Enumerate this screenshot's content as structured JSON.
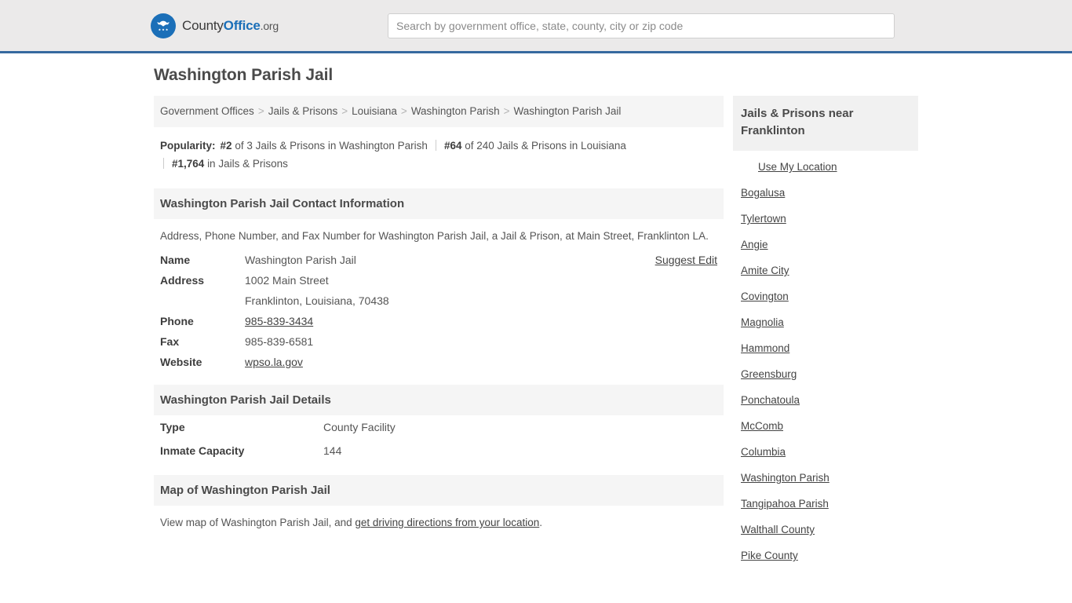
{
  "header": {
    "brand": {
      "part1": "County",
      "part2": "Office",
      "part3": ".org",
      "logo_icon": "eagle-seal-icon"
    },
    "search": {
      "placeholder": "Search by government office, state, county, city or zip code",
      "value": ""
    },
    "accent_color": "#36699f",
    "background_color": "#ebeaea"
  },
  "page": {
    "title": "Washington Parish Jail"
  },
  "breadcrumb": {
    "separator": ">",
    "items": [
      {
        "label": "Government Offices",
        "current": false
      },
      {
        "label": "Jails & Prisons",
        "current": false
      },
      {
        "label": "Louisiana",
        "current": false
      },
      {
        "label": "Washington Parish",
        "current": false
      },
      {
        "label": "Washington Parish Jail",
        "current": true
      }
    ]
  },
  "popularity": {
    "label": "Popularity:",
    "stats": [
      {
        "rank": "#2",
        "text": "of 3 Jails & Prisons in Washington Parish"
      },
      {
        "rank": "#64",
        "text": "of 240 Jails & Prisons in Louisiana"
      },
      {
        "rank": "#1,764",
        "text": "in Jails & Prisons"
      }
    ]
  },
  "contact": {
    "heading": "Washington Parish Jail Contact Information",
    "description": "Address, Phone Number, and Fax Number for Washington Parish Jail, a Jail & Prison, at Main Street, Franklinton LA.",
    "suggest_edit": "Suggest Edit",
    "rows": [
      {
        "key": "Name",
        "value": "Washington Parish Jail",
        "link": false
      },
      {
        "key": "Address",
        "value": "1002 Main Street",
        "link": false
      },
      {
        "key": "",
        "value": "Franklinton, Louisiana, 70438",
        "link": false
      },
      {
        "key": "Phone",
        "value": "985-839-3434",
        "link": true
      },
      {
        "key": "Fax",
        "value": "985-839-6581",
        "link": false
      },
      {
        "key": "Website",
        "value": "wpso.la.gov",
        "link": true
      }
    ]
  },
  "details": {
    "heading": "Washington Parish Jail Details",
    "rows": [
      {
        "key": "Type",
        "value": "County Facility"
      },
      {
        "key": "Inmate Capacity",
        "value": "144"
      }
    ]
  },
  "map": {
    "heading": "Map of Washington Parish Jail",
    "text_before": "View map of Washington Parish Jail, and ",
    "link": "get driving directions from your location",
    "text_after": "."
  },
  "sidebar": {
    "heading": "Jails & Prisons near Franklinton",
    "use_my_location": "Use My Location",
    "items": [
      {
        "label": "Bogalusa"
      },
      {
        "label": "Tylertown"
      },
      {
        "label": "Angie"
      },
      {
        "label": "Amite City"
      },
      {
        "label": "Covington"
      },
      {
        "label": "Magnolia"
      },
      {
        "label": "Hammond"
      },
      {
        "label": "Greensburg"
      },
      {
        "label": "Ponchatoula"
      },
      {
        "label": "McComb"
      },
      {
        "label": "Columbia"
      },
      {
        "label": "Washington Parish"
      },
      {
        "label": "Tangipahoa Parish"
      },
      {
        "label": "Walthall County"
      },
      {
        "label": "Pike County"
      }
    ]
  }
}
